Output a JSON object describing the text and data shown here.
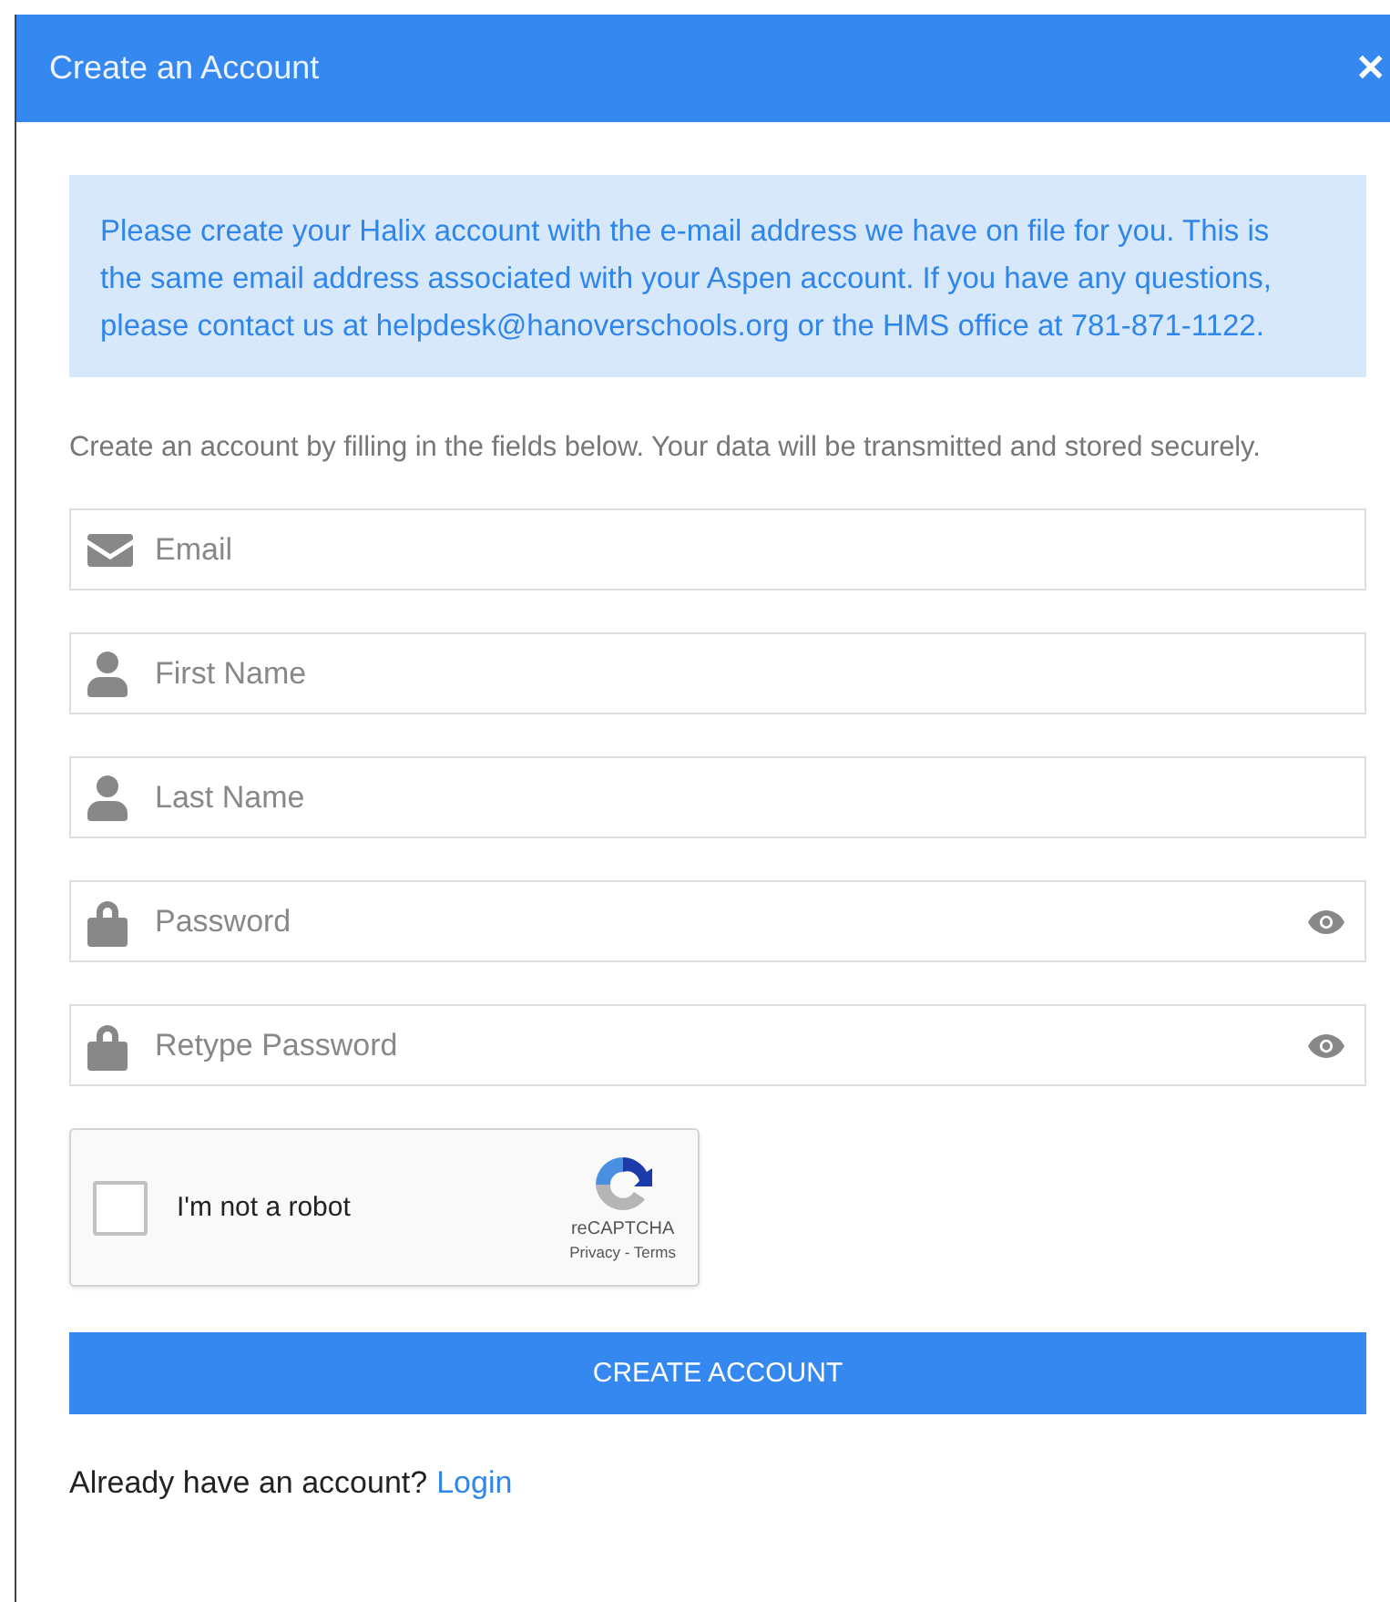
{
  "dialog": {
    "title": "Create an Account",
    "close": "✕"
  },
  "notice": "Please create your Halix account with the e-mail address we have on file for you. This is the same email address associated with your Aspen account. If you have any questions, please contact us at helpdesk@hanoverschools.org or the HMS office at 781-871-1122.",
  "instructions": "Create an account by filling in the fields below. Your data will be transmitted and stored securely.",
  "fields": [
    {
      "kind": "email",
      "placeholder": "Email",
      "reveal": false
    },
    {
      "kind": "person",
      "placeholder": "First Name",
      "reveal": false
    },
    {
      "kind": "person",
      "placeholder": "Last Name",
      "reveal": false
    },
    {
      "kind": "lock",
      "placeholder": "Password",
      "reveal": true
    },
    {
      "kind": "lock",
      "placeholder": "Retype Password",
      "reveal": true
    }
  ],
  "captcha": {
    "label": "I'm not a robot",
    "checked": false,
    "brand": "reCAPTCHA",
    "links": "Privacy - Terms"
  },
  "submit": "CREATE ACCOUNT",
  "footer": {
    "text": "Already have an account?",
    "link": "Login"
  }
}
